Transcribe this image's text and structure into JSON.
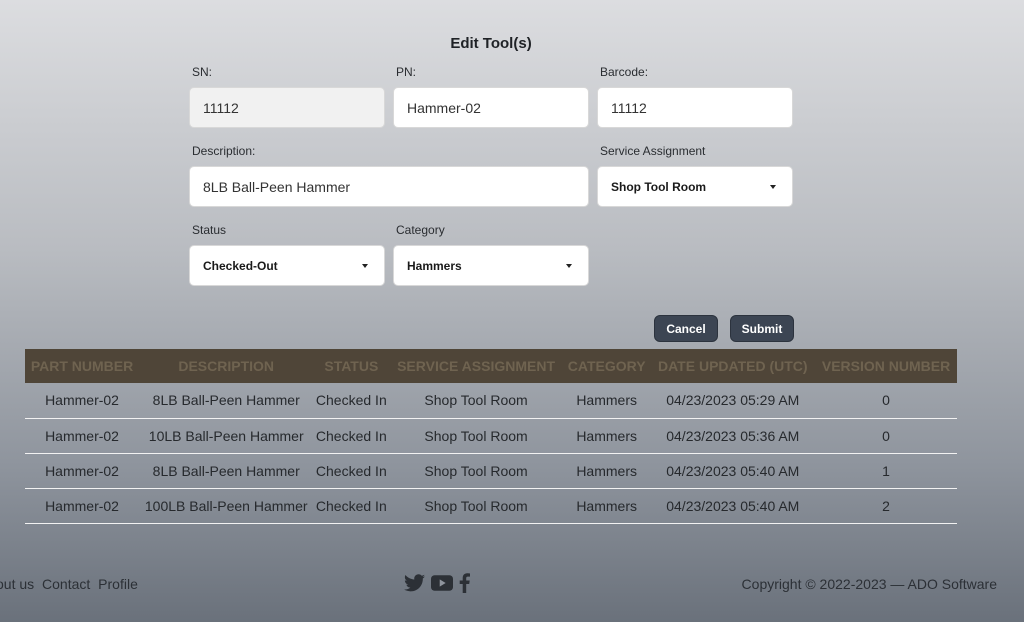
{
  "form": {
    "title": "Edit Tool(s)",
    "sn_label": "SN:",
    "sn_value": "11112",
    "pn_label": "PN:",
    "pn_value": "Hammer-02",
    "barcode_label": "Barcode:",
    "barcode_value": "11112",
    "description_label": "Description:",
    "description_value": "8LB Ball-Peen Hammer",
    "service_label": "Service Assignment",
    "service_value": "Shop Tool Room",
    "status_label": "Status",
    "status_value": "Checked-Out",
    "category_label": "Category",
    "category_value": "Hammers",
    "cancel_label": "Cancel",
    "submit_label": "Submit"
  },
  "table": {
    "headers": [
      "PART NUMBER",
      "DESCRIPTION",
      "STATUS",
      "SERVICE ASSIGNMENT",
      "CATEGORY",
      "DATE UPDATED (UTC)",
      "VERSION NUMBER"
    ],
    "rows": [
      [
        "Hammer-02",
        "8LB Ball-Peen Hammer",
        "Checked In",
        "Shop Tool Room",
        "Hammers",
        "04/23/2023 05:29 AM",
        "0"
      ],
      [
        "Hammer-02",
        "10LB Ball-Peen Hammer",
        "Checked In",
        "Shop Tool Room",
        "Hammers",
        "04/23/2023 05:36 AM",
        "0"
      ],
      [
        "Hammer-02",
        "8LB Ball-Peen Hammer",
        "Checked In",
        "Shop Tool Room",
        "Hammers",
        "04/23/2023 05:40 AM",
        "1"
      ],
      [
        "Hammer-02",
        "100LB Ball-Peen Hammer",
        "Checked In",
        "Shop Tool Room",
        "Hammers",
        "04/23/2023 05:40 AM",
        "2"
      ]
    ]
  },
  "footer": {
    "links": [
      "out us",
      "Contact",
      "Profile"
    ],
    "social_icons": [
      "twitter-icon",
      "youtube-icon",
      "facebook-icon"
    ],
    "copyright": "Copyright © 2022-2023 — ADO Software"
  }
}
